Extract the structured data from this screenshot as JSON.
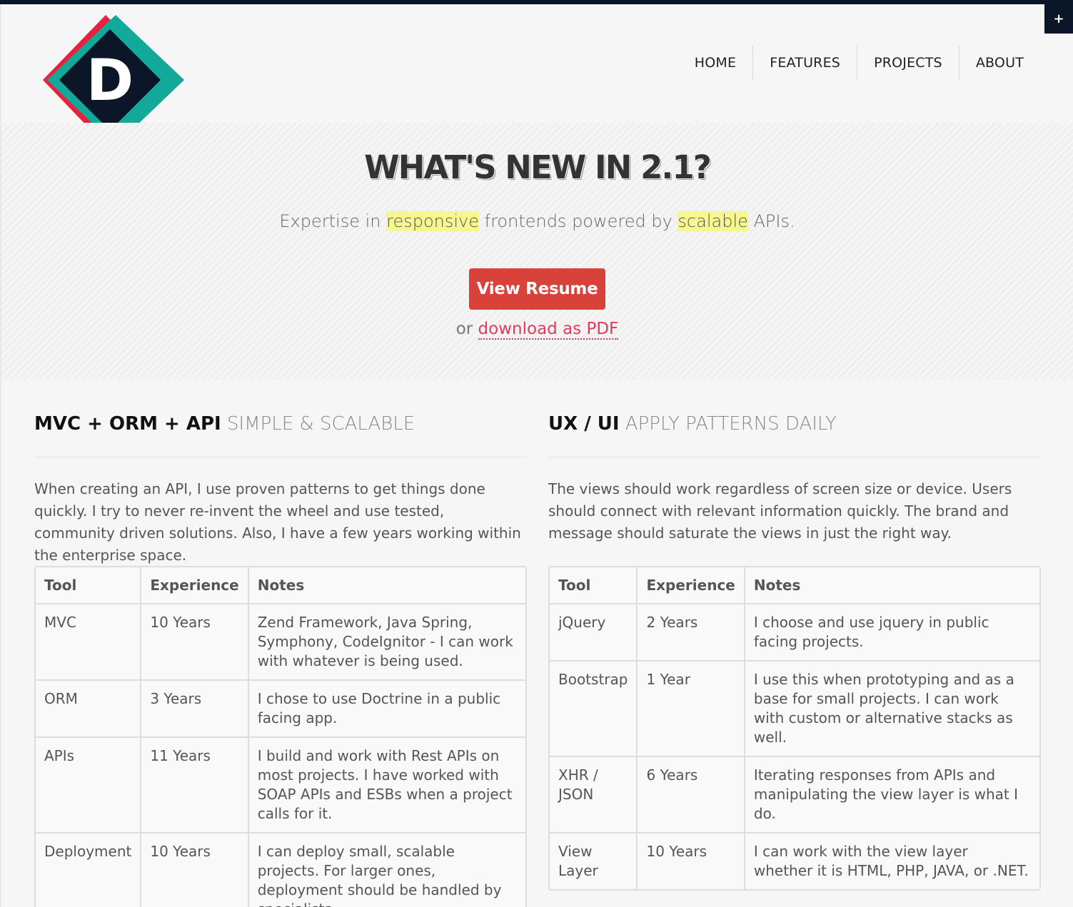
{
  "logo": {
    "letter": "D"
  },
  "toggle": {
    "label": "+"
  },
  "nav": {
    "items": [
      {
        "label": "HOME"
      },
      {
        "label": "FEATURES"
      },
      {
        "label": "PROJECTS"
      },
      {
        "label": "ABOUT"
      }
    ]
  },
  "hero": {
    "title": "WHAT'S NEW IN 2.1?",
    "tagline": {
      "part1": "Expertise in ",
      "highlight1": "responsive",
      "part2": " frontends powered by ",
      "highlight2": "scalable",
      "part3": " APIs."
    },
    "cta_label": "View Resume",
    "pdf_prefix": "or ",
    "pdf_link": "download as PDF"
  },
  "left": {
    "heading_main": "MVC + ORM + API",
    "heading_sub": " SIMPLE & SCALABLE",
    "text": "When creating an API, I use proven patterns to get things done quickly. I try to never re-invent the wheel and use tested, community driven solutions. Also, I have a few years working within the enterprise space.",
    "columns": [
      "Tool",
      "Experience",
      "Notes"
    ],
    "rows": [
      {
        "tool": "MVC",
        "experience": "10 Years",
        "notes": "Zend Framework, Java Spring, Symphony, CodeIgnitor - I can work with whatever is being used."
      },
      {
        "tool": "ORM",
        "experience": "3 Years",
        "notes": "I chose to use Doctrine in a public facing app."
      },
      {
        "tool": "APIs",
        "experience": "11 Years",
        "notes": "I build and work with Rest APIs on most projects. I have worked with SOAP APIs and ESBs when a project calls for it."
      },
      {
        "tool": "Deployment",
        "experience": "10 Years",
        "notes": "I can deploy small, scalable projects. For larger ones, deployment should be handled by specialists."
      }
    ]
  },
  "right": {
    "heading_main": "UX / UI",
    "heading_sub": " APPLY PATTERNS DAILY",
    "text": "The views should work regardless of screen size or device. Users should connect with relevant information quickly. The brand and message should saturate the views in just the right way.",
    "columns": [
      "Tool",
      "Experience",
      "Notes"
    ],
    "rows": [
      {
        "tool": "jQuery",
        "experience": "2 Years",
        "notes": "I choose and use jquery in public facing projects."
      },
      {
        "tool": "Bootstrap",
        "experience": "1 Year",
        "notes": "I use this when prototyping and as a base for small projects. I can work with custom or alternative stacks as well."
      },
      {
        "tool": "XHR / JSON",
        "experience": "6 Years",
        "notes": "Iterating responses from APIs and manipulating the view layer is what I do."
      },
      {
        "tool": "View Layer",
        "experience": "10 Years",
        "notes": "I can work with the view layer whether it is HTML, PHP, JAVA, or .NET."
      }
    ]
  },
  "colors": {
    "accent_red": "#d9423b",
    "logo_red": "#e8213f",
    "logo_teal": "#12a89a",
    "logo_navy": "#0b1628",
    "highlight": "#f6f88f",
    "link": "#e23b5a"
  }
}
